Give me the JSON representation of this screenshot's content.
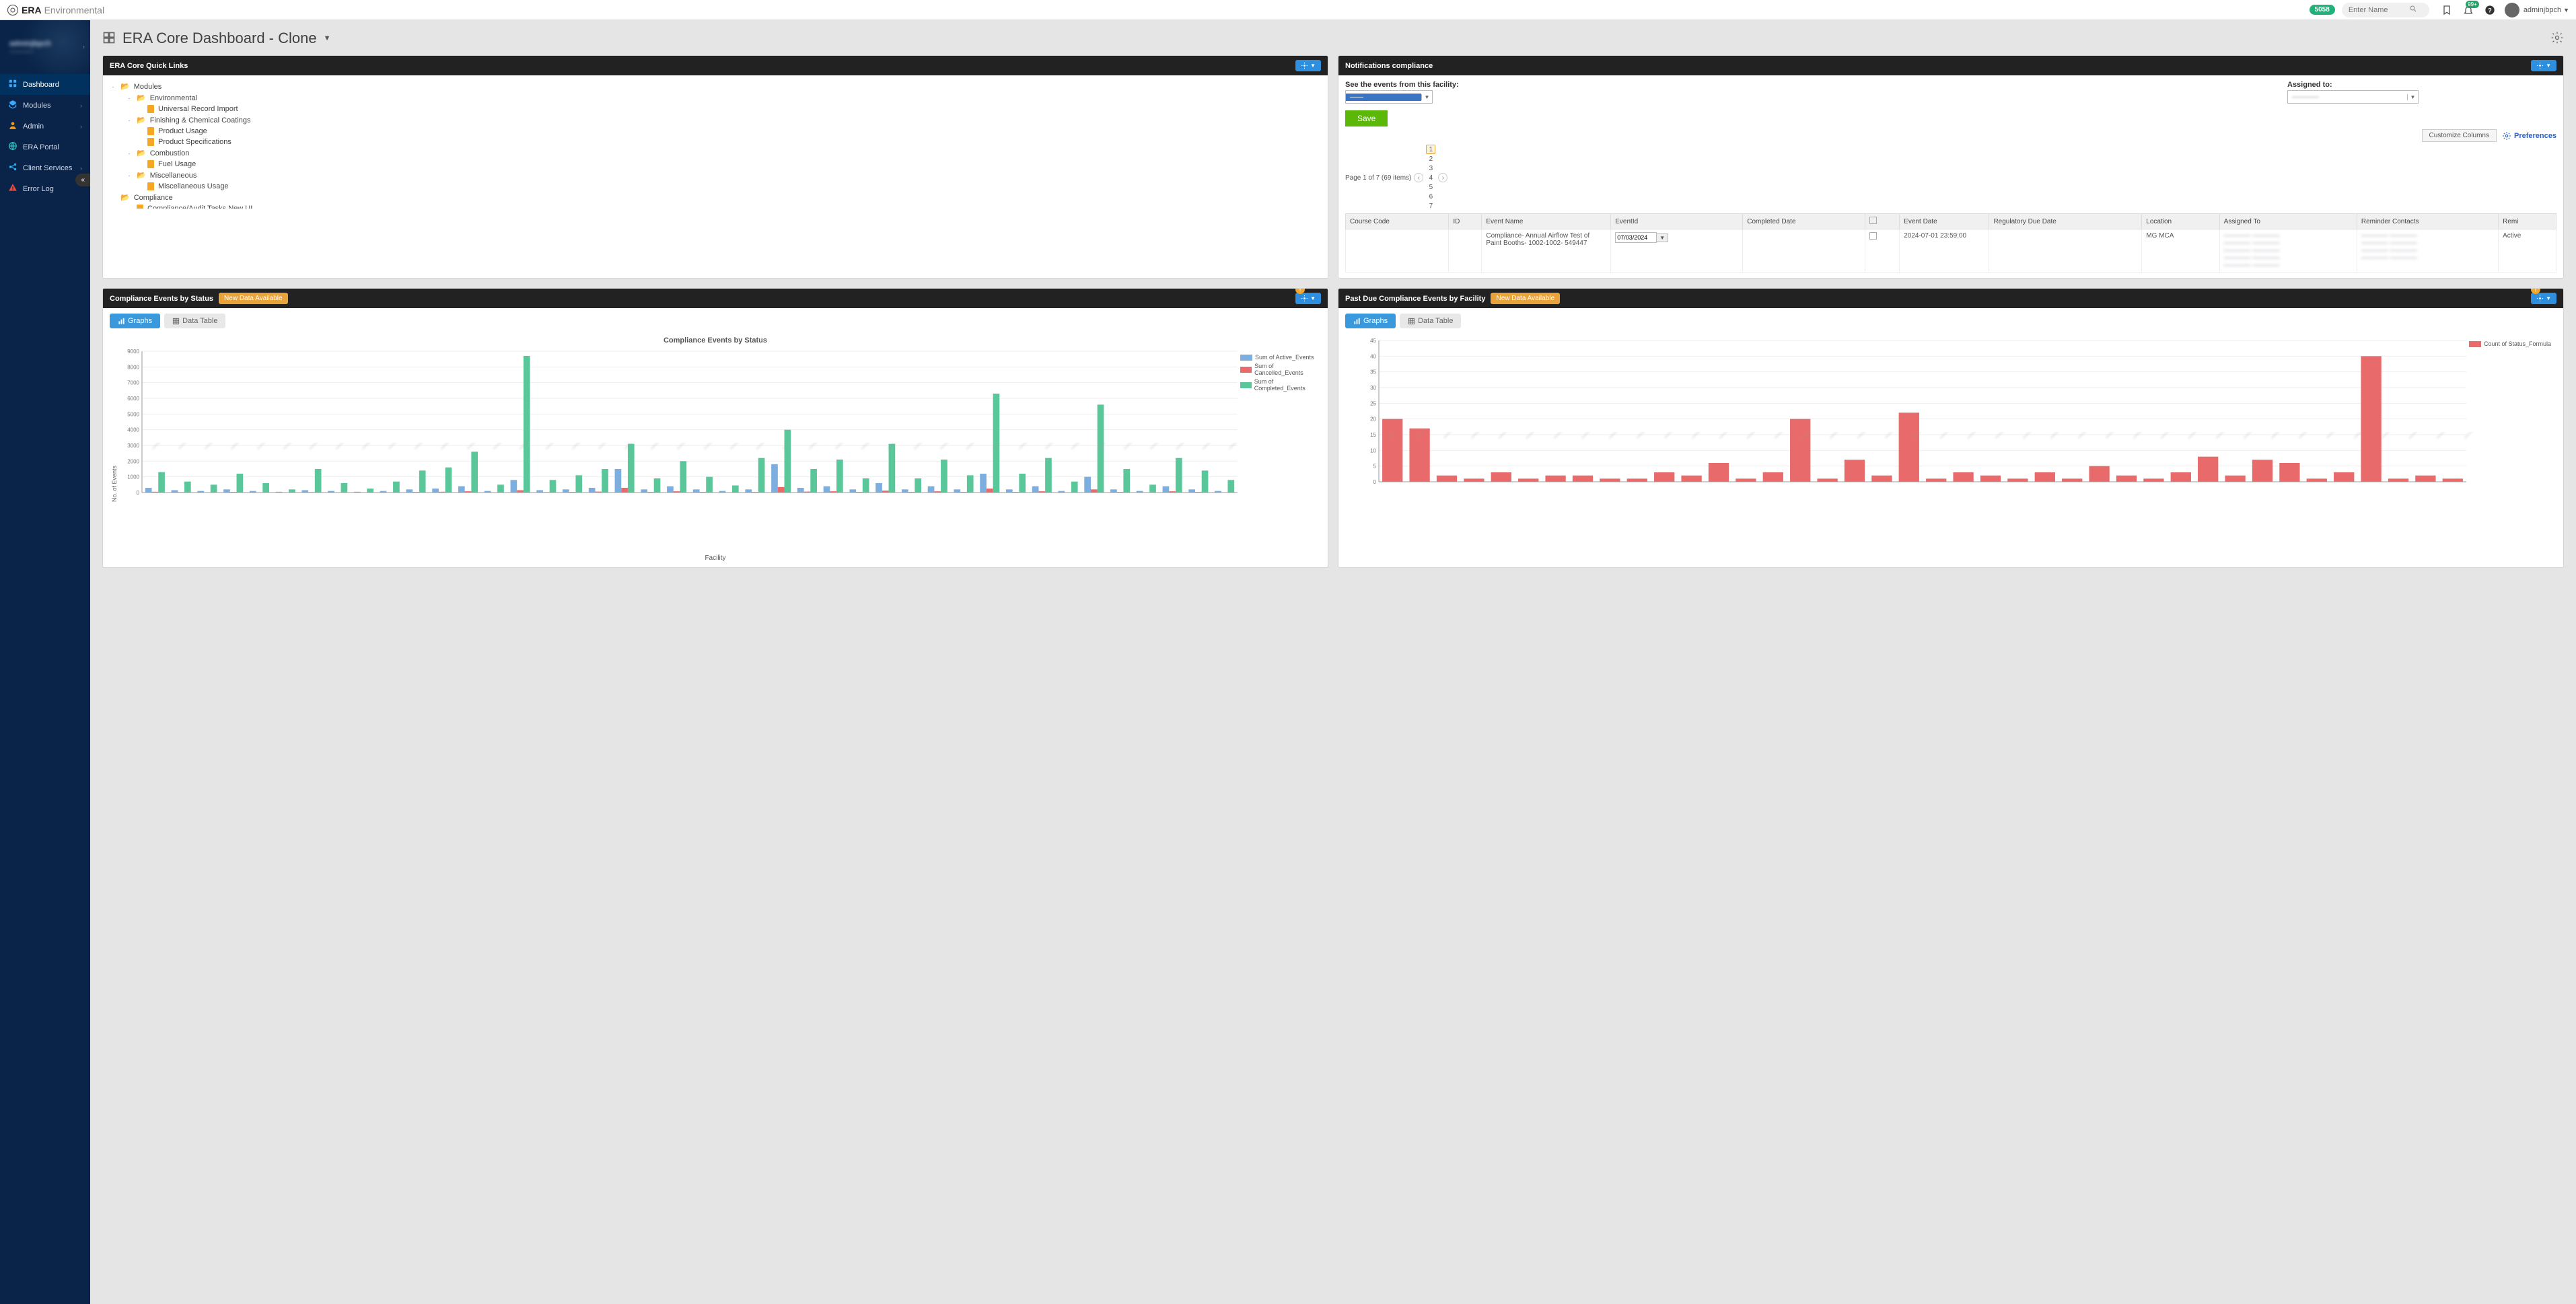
{
  "brand": {
    "bold": "ERA",
    "light": "Environmental"
  },
  "top": {
    "badge": "5058",
    "search_placeholder": "Enter Name",
    "notif_badge": "99+",
    "username": "adminjbpch"
  },
  "sidebar": {
    "user_name": "adminjbpch",
    "user_sub": "————",
    "items": [
      {
        "label": "Dashboard",
        "icon": "grid",
        "color": "ic-blue",
        "active": true,
        "chev": false
      },
      {
        "label": "Modules",
        "icon": "cubes",
        "color": "ic-blue",
        "active": false,
        "chev": true
      },
      {
        "label": "Admin",
        "icon": "user",
        "color": "ic-orange",
        "active": false,
        "chev": true
      },
      {
        "label": "ERA Portal",
        "icon": "globe",
        "color": "ic-teal",
        "active": false,
        "chev": false
      },
      {
        "label": "Client Services",
        "icon": "share",
        "color": "ic-cyan",
        "active": false,
        "chev": true
      },
      {
        "label": "Error Log",
        "icon": "alert",
        "color": "ic-red",
        "active": false,
        "chev": false
      }
    ]
  },
  "page": {
    "title": "ERA Core Dashboard - Clone"
  },
  "panels": {
    "quicklinks": {
      "title": "ERA Core Quick Links"
    },
    "notif": {
      "title": "Notifications compliance"
    },
    "status": {
      "title": "Compliance Events by Status",
      "badge": "New Data Available"
    },
    "pastdue": {
      "title": "Past Due Compliance Events by Facility",
      "badge": "New Data Available"
    }
  },
  "tree": [
    {
      "lvl": 0,
      "type": "folder-open",
      "tog": "-",
      "label": "Modules"
    },
    {
      "lvl": 1,
      "type": "folder-open",
      "tog": "-",
      "label": "Environmental"
    },
    {
      "lvl": 2,
      "type": "file",
      "label": "Universal Record Import"
    },
    {
      "lvl": 1,
      "type": "folder-open",
      "tog": "-",
      "label": "Finishing & Chemical Coatings"
    },
    {
      "lvl": 2,
      "type": "file",
      "label": "Product Usage"
    },
    {
      "lvl": 2,
      "type": "file",
      "label": "Product Specifications"
    },
    {
      "lvl": 1,
      "type": "folder-open",
      "tog": "-",
      "label": "Combustion"
    },
    {
      "lvl": 2,
      "type": "file",
      "label": "Fuel Usage"
    },
    {
      "lvl": 1,
      "type": "folder-open",
      "tog": "-",
      "label": "Miscellaneous"
    },
    {
      "lvl": 2,
      "type": "file",
      "label": "Miscellaneous Usage"
    },
    {
      "lvl": 0,
      "type": "folder-open",
      "tog": "",
      "label": "Compliance"
    },
    {
      "lvl": 1,
      "type": "file",
      "label": "Compliance/Audit Tasks New UI"
    }
  ],
  "notif": {
    "facility_label": "See the events from this facility:",
    "assigned_label": "Assigned to:",
    "facility_val": "——",
    "assigned_val": "————",
    "save": "Save",
    "customize": "Customize Columns",
    "preferences": "Preferences",
    "pager_text": "Page 1 of 7 (69 items)",
    "pages": [
      "1",
      "2",
      "3",
      "4",
      "5",
      "6",
      "7"
    ],
    "cols": [
      "Course Code",
      "ID",
      "Event Name",
      "EventId",
      "Completed Date",
      "",
      "Event Date",
      "Regulatory Due Date",
      "Location",
      "Assigned To",
      "Reminder Contacts",
      "Remi"
    ],
    "row": {
      "event_name": "Compliance- Annual Airflow Test of Paint Booths- 1002-1002- 549447",
      "eventid_date": "07/03/2024",
      "event_date": "2024-07-01 23:59:00",
      "location": "MG MCA",
      "assigned": "———— ————\n———— ————\n———— ————\n———— ————\n———— ————",
      "reminder": "———— ————\n———— ————\n———— ————\n———— ————",
      "status": "Active"
    }
  },
  "tabs": {
    "graphs": "Graphs",
    "table": "Data Table"
  },
  "chart_data": [
    {
      "type": "bar",
      "title": "Compliance Events by Status",
      "xlabel": "Facility",
      "ylabel": "No. of Events",
      "ylim": [
        0,
        9000
      ],
      "yticks": [
        0,
        1000,
        2000,
        3000,
        4000,
        5000,
        6000,
        7000,
        8000,
        9000
      ],
      "series": [
        {
          "name": "Sum of Active_Events",
          "color": "#7daee0",
          "values": [
            300,
            150,
            100,
            200,
            100,
            50,
            150,
            100,
            50,
            100,
            200,
            250,
            400,
            100,
            800,
            150,
            200,
            300,
            1500,
            200,
            400,
            200,
            100,
            200,
            1800,
            300,
            400,
            200,
            600,
            200,
            400,
            200,
            1200,
            200,
            400,
            100,
            1000,
            200,
            100,
            400,
            200,
            100
          ]
        },
        {
          "name": "Sum of Cancelled_Events",
          "color": "#e96a6a",
          "values": [
            50,
            30,
            20,
            40,
            20,
            10,
            30,
            20,
            10,
            20,
            40,
            50,
            80,
            20,
            150,
            30,
            40,
            60,
            300,
            40,
            80,
            40,
            20,
            40,
            350,
            60,
            80,
            40,
            120,
            40,
            80,
            40,
            250,
            40,
            80,
            20,
            200,
            40,
            20,
            80,
            40,
            20
          ]
        },
        {
          "name": "Sum of Completed_Events",
          "color": "#5ac79a",
          "values": [
            1300,
            700,
            500,
            1200,
            600,
            200,
            1500,
            600,
            250,
            700,
            1400,
            1600,
            2600,
            500,
            8700,
            800,
            1100,
            1500,
            3100,
            900,
            2000,
            1000,
            450,
            2200,
            4000,
            1500,
            2100,
            900,
            3100,
            900,
            2100,
            1100,
            6300,
            1200,
            2200,
            700,
            5600,
            1500,
            500,
            2200,
            1400,
            800
          ]
        }
      ],
      "categories": [
        "——",
        "——",
        "——",
        "——",
        "——",
        "——",
        "——",
        "——",
        "——",
        "——",
        "——",
        "——",
        "——",
        "——",
        "——",
        "——",
        "——",
        "——",
        "——",
        "——",
        "——",
        "——",
        "——",
        "——",
        "——",
        "——",
        "——",
        "——",
        "——",
        "——",
        "——",
        "——",
        "——",
        "——",
        "——",
        "——",
        "——",
        "——",
        "——",
        "——",
        "——",
        "——"
      ]
    },
    {
      "type": "bar",
      "title": "",
      "xlabel": "",
      "ylabel": "",
      "ylim": [
        0,
        45
      ],
      "yticks": [
        0,
        5,
        10,
        15,
        20,
        25,
        30,
        35,
        40,
        45
      ],
      "series": [
        {
          "name": "Count of Status_Formula",
          "color": "#e96a6a",
          "values": [
            20,
            17,
            2,
            1,
            3,
            1,
            2,
            2,
            1,
            1,
            3,
            2,
            6,
            1,
            3,
            20,
            1,
            7,
            2,
            22,
            1,
            3,
            2,
            1,
            3,
            1,
            5,
            2,
            1,
            3,
            8,
            2,
            7,
            6,
            1,
            3,
            40,
            1,
            2,
            1
          ]
        }
      ],
      "categories": [
        "——",
        "——",
        "——",
        "——",
        "——",
        "——",
        "——",
        "——",
        "——",
        "——",
        "——",
        "——",
        "——",
        "——",
        "——",
        "——",
        "——",
        "——",
        "——",
        "——",
        "——",
        "——",
        "——",
        "——",
        "——",
        "——",
        "——",
        "——",
        "——",
        "——",
        "——",
        "——",
        "——",
        "——",
        "——",
        "——",
        "——",
        "——",
        "——",
        "——"
      ]
    }
  ]
}
